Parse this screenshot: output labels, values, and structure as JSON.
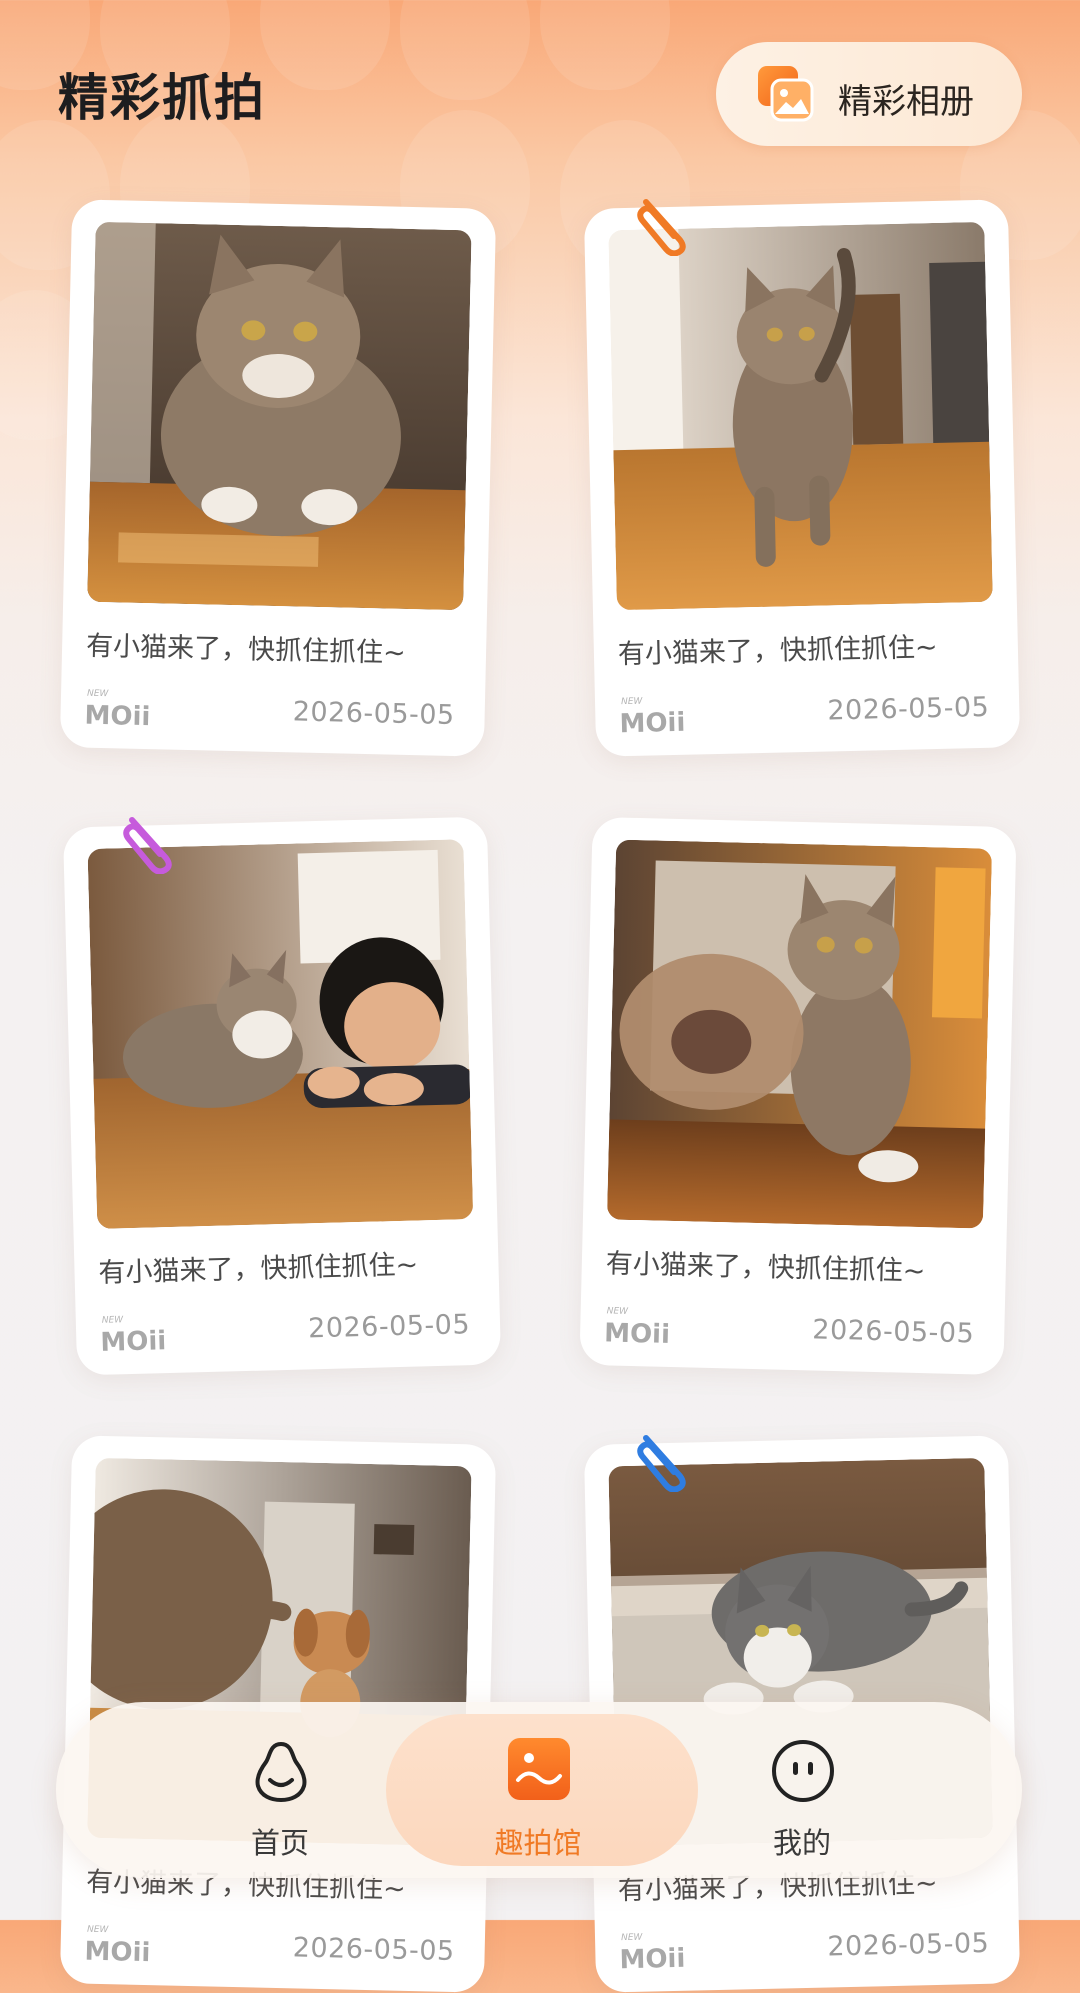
{
  "header": {
    "title": "精彩抓拍",
    "album_button_label": "精彩相册",
    "album_icon": "album-icon"
  },
  "cards": [
    {
      "caption": "有小猫来了，快抓住抓住~",
      "date": "2026-05-05",
      "brand": "MOii",
      "photo": "cat-approaching-photo"
    },
    {
      "caption": "有小猫来了，快抓住抓住~",
      "date": "2026-05-05",
      "brand": "MOii",
      "photo": "cat-walking-photo",
      "clip_color": "#f07a25"
    },
    {
      "caption": "有小猫来了，快抓住抓住~",
      "date": "2026-05-05",
      "brand": "MOii",
      "photo": "cat-and-child-photo",
      "clip_color": "#c65bdc"
    },
    {
      "caption": "有小猫来了，快抓住抓住~",
      "date": "2026-05-05",
      "brand": "MOii",
      "photo": "cat-paw-photo"
    },
    {
      "caption": "有小猫来了，快抓住抓住~",
      "date": "2026-05-05",
      "brand": "MOii",
      "photo": "cat-and-dog-photo"
    },
    {
      "caption": "有小猫来了，快抓住抓住~",
      "date": "2026-05-05",
      "brand": "MOii",
      "photo": "cat-crouching-photo",
      "clip_color": "#2f7de1"
    }
  ],
  "tabbar": {
    "items": [
      {
        "label": "首页",
        "icon": "home-face-icon",
        "active": false
      },
      {
        "label": "趣拍馆",
        "icon": "gallery-icon",
        "active": true
      },
      {
        "label": "我的",
        "icon": "profile-face-icon",
        "active": false
      }
    ]
  },
  "colors": {
    "accent": "#f07a25",
    "header_gradient_top": "#f9a877",
    "background": "#f3f1f2"
  }
}
